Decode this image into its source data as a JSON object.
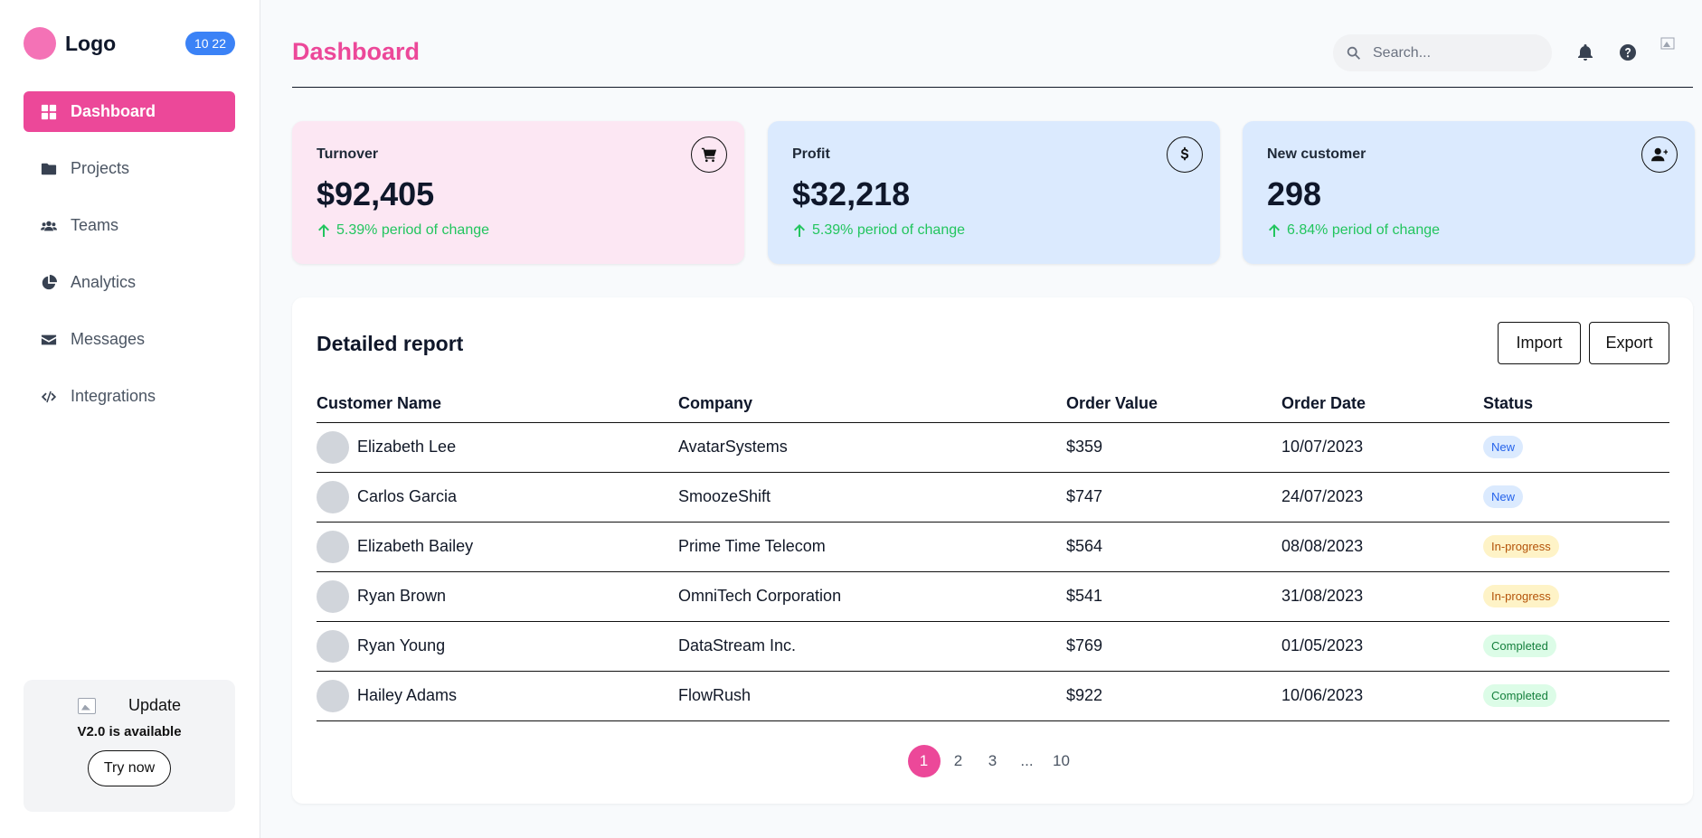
{
  "sidebar": {
    "logo_text": "Logo",
    "time_badge": "10 22",
    "nav": [
      {
        "label": "Dashboard",
        "icon": "grid-icon",
        "active": true
      },
      {
        "label": "Projects",
        "icon": "folder-icon"
      },
      {
        "label": "Teams",
        "icon": "users-icon"
      },
      {
        "label": "Analytics",
        "icon": "pie-chart-icon"
      },
      {
        "label": "Messages",
        "icon": "envelope-icon"
      },
      {
        "label": "Integrations",
        "icon": "code-icon"
      }
    ],
    "update": {
      "title": "Update",
      "subtitle": "V2.0 is available",
      "button": "Try now"
    }
  },
  "header": {
    "title": "Dashboard",
    "search_placeholder": "Search...",
    "avatar_alt": "avatar"
  },
  "cards": [
    {
      "label": "Turnover",
      "value": "$92,405",
      "change": "5.39% period of change",
      "icon": "cart-icon"
    },
    {
      "label": "Profit",
      "value": "$32,218",
      "change": "5.39% period of change",
      "icon": "dollar-icon"
    },
    {
      "label": "New customer",
      "value": "298",
      "change": "6.84% period of change",
      "icon": "user-plus-icon"
    }
  ],
  "report": {
    "title": "Detailed report",
    "import_label": "Import",
    "export_label": "Export",
    "columns": [
      "Customer Name",
      "Company",
      "Order Value",
      "Order Date",
      "Status"
    ],
    "rows": [
      {
        "name": "Elizabeth Lee",
        "company": "AvatarSystems",
        "value": "$359",
        "date": "10/07/2023",
        "status": "New"
      },
      {
        "name": "Carlos Garcia",
        "company": "SmoozeShift",
        "value": "$747",
        "date": "24/07/2023",
        "status": "New"
      },
      {
        "name": "Elizabeth Bailey",
        "company": "Prime Time Telecom",
        "value": "$564",
        "date": "08/08/2023",
        "status": "In-progress"
      },
      {
        "name": "Ryan Brown",
        "company": "OmniTech Corporation",
        "value": "$541",
        "date": "31/08/2023",
        "status": "In-progress"
      },
      {
        "name": "Ryan Young",
        "company": "DataStream Inc.",
        "value": "$769",
        "date": "01/05/2023",
        "status": "Completed"
      },
      {
        "name": "Hailey Adams",
        "company": "FlowRush",
        "value": "$922",
        "date": "10/06/2023",
        "status": "Completed"
      }
    ],
    "pagination": [
      "1",
      "2",
      "3",
      "...",
      "10"
    ]
  },
  "colors": {
    "accent": "#ec4899",
    "positive": "#22c55e",
    "card_pink": "#fce7f3",
    "card_blue": "#dbeafe"
  }
}
